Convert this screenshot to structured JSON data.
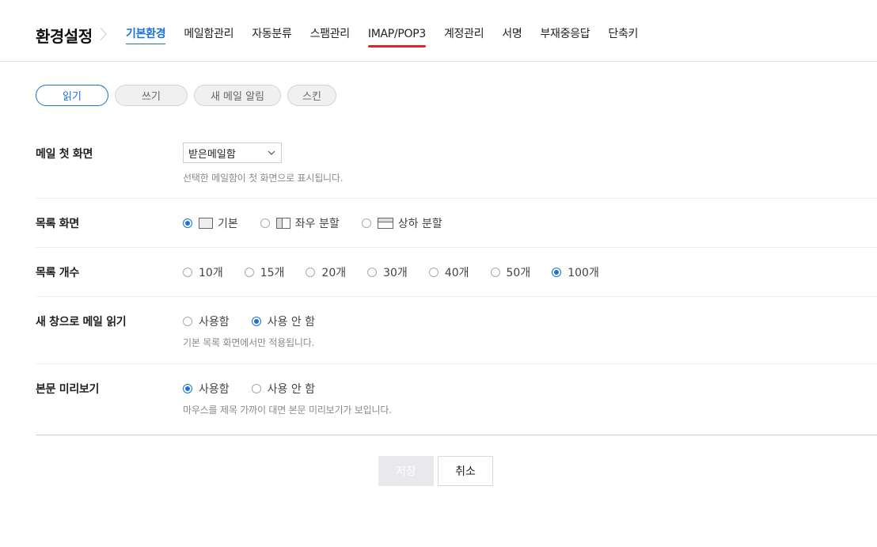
{
  "header": {
    "title": "환경설정",
    "tabs": [
      {
        "label": "기본환경",
        "active": true
      },
      {
        "label": "메일함관리"
      },
      {
        "label": "자동분류"
      },
      {
        "label": "스팸관리"
      },
      {
        "label": "IMAP/POP3",
        "marked": true
      },
      {
        "label": "계정관리"
      },
      {
        "label": "서명"
      },
      {
        "label": "부재중응답"
      },
      {
        "label": "단축키"
      }
    ]
  },
  "subtabs": [
    {
      "label": "읽기",
      "active": true
    },
    {
      "label": "쓰기"
    },
    {
      "label": "새 메일 알림"
    },
    {
      "label": "스킨"
    }
  ],
  "settings": {
    "first_screen": {
      "label": "메일 첫 화면",
      "value": "받은메일함",
      "hint": "선택한 메일함이 첫 화면으로 표시됩니다."
    },
    "list_view": {
      "label": "목록 화면",
      "options": [
        "기본",
        "좌우 분할",
        "상하 분할"
      ],
      "selected": "기본"
    },
    "list_count": {
      "label": "목록 개수",
      "options": [
        "10개",
        "15개",
        "20개",
        "30개",
        "40개",
        "50개",
        "100개"
      ],
      "selected": "100개"
    },
    "new_window": {
      "label": "새 창으로 메일 읽기",
      "options": [
        "사용함",
        "사용 안 함"
      ],
      "selected": "사용 안 함",
      "hint": "기본 목록 화면에서만 적용됩니다."
    },
    "preview": {
      "label": "본문 미리보기",
      "options": [
        "사용함",
        "사용 안 함"
      ],
      "selected": "사용함",
      "hint": "마우스를 제목 가까이 대면 본문 미리보기가 보입니다."
    }
  },
  "buttons": {
    "save": "저장",
    "cancel": "취소"
  },
  "colors": {
    "accent": "#1a72d6",
    "highlight_underline": "#e8202a"
  }
}
